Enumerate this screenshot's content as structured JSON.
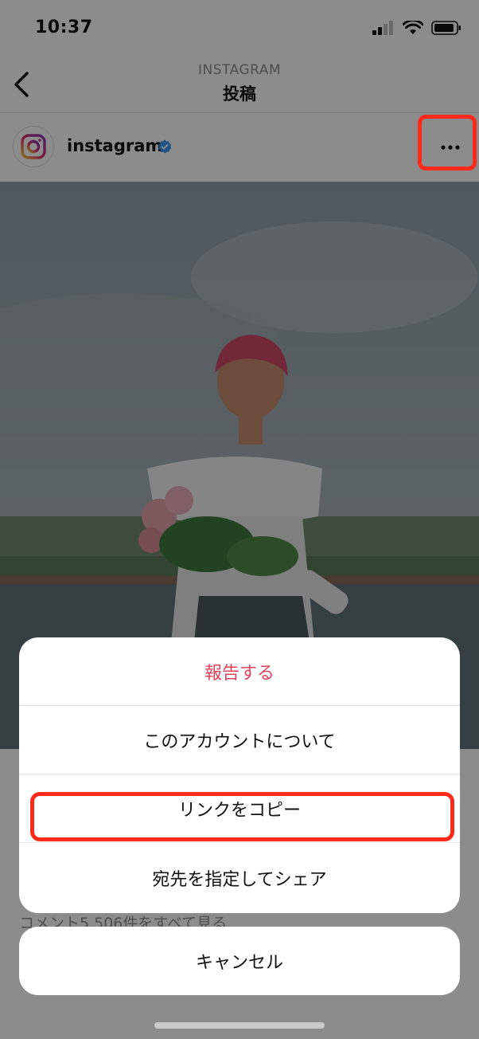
{
  "status_bar": {
    "time": "10:37"
  },
  "nav": {
    "subtitle": "INSTAGRAM",
    "title": "投稿"
  },
  "post": {
    "username": "instagram",
    "verified": true,
    "comments_link": "コメント5,506件をすべて見る"
  },
  "action_sheet": {
    "items": [
      {
        "label": "報告する",
        "style": "destructive"
      },
      {
        "label": "このアカウントについて"
      },
      {
        "label": "リンクをコピー",
        "highlighted": true
      },
      {
        "label": "宛先を指定してシェア"
      }
    ],
    "cancel_label": "キャンセル"
  },
  "colors": {
    "destructive": "#e0445c",
    "highlight": "#ff2a1a",
    "verified": "#3897f0"
  }
}
